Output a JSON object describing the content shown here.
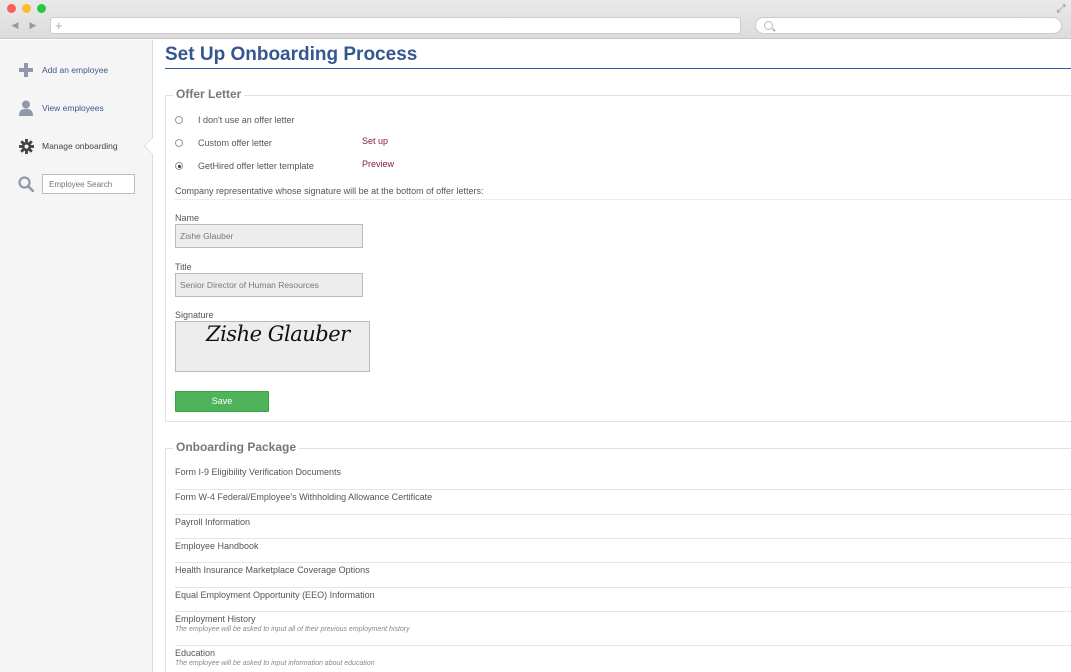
{
  "browser": {
    "back": "◀",
    "forward": "▶",
    "new_tab": "+",
    "address_value": "",
    "search_value": ""
  },
  "sidebar": {
    "items": [
      {
        "label": "Add an employee",
        "icon": "plus-icon"
      },
      {
        "label": "View employees",
        "icon": "person-icon"
      },
      {
        "label": "Manage onboarding",
        "icon": "gear-icon",
        "active": true
      }
    ],
    "search_placeholder": "Employee Search"
  },
  "page": {
    "title": "Set Up Onboarding Process"
  },
  "offer_letter": {
    "legend": "Offer Letter",
    "options": [
      {
        "label": "I don't use an offer letter",
        "checked": false
      },
      {
        "label": "Custom offer letter",
        "checked": false,
        "link": "Set up"
      },
      {
        "label": "GetHired offer letter template",
        "checked": true,
        "link": "Preview"
      }
    ],
    "rep_text": "Company representative whose signature will be at the bottom of offer letters:",
    "name_label": "Name",
    "name_value": "Zishe Glauber",
    "title_label": "Title",
    "title_value": "Senior Director of Human Resources",
    "signature_label": "Signature",
    "signature_value": "Zishe Glauber",
    "save_label": "Save"
  },
  "onboarding_package": {
    "legend": "Onboarding Package",
    "items": [
      {
        "title": "Form I-9 Eligibility Verification Documents",
        "desc": ""
      },
      {
        "title": "Form W-4 Federal/Employee's Withholding Allowance Certificate",
        "desc": ""
      },
      {
        "title": "Payroll Information",
        "desc": ""
      },
      {
        "title": "Employee Handbook",
        "desc": ""
      },
      {
        "title": "Health Insurance Marketplace Coverage Options",
        "desc": ""
      },
      {
        "title": "Equal Employment Opportunity (EEO) Information",
        "desc": ""
      },
      {
        "title": "Employment History",
        "desc": "The employee will be asked to input all of their previous employment history"
      },
      {
        "title": "Education",
        "desc": "The employee will be asked to input information about education"
      }
    ]
  },
  "colors": {
    "title_blue": "#34578f",
    "link_maroon": "#8b1a3a",
    "save_green": "#4eb35a"
  }
}
